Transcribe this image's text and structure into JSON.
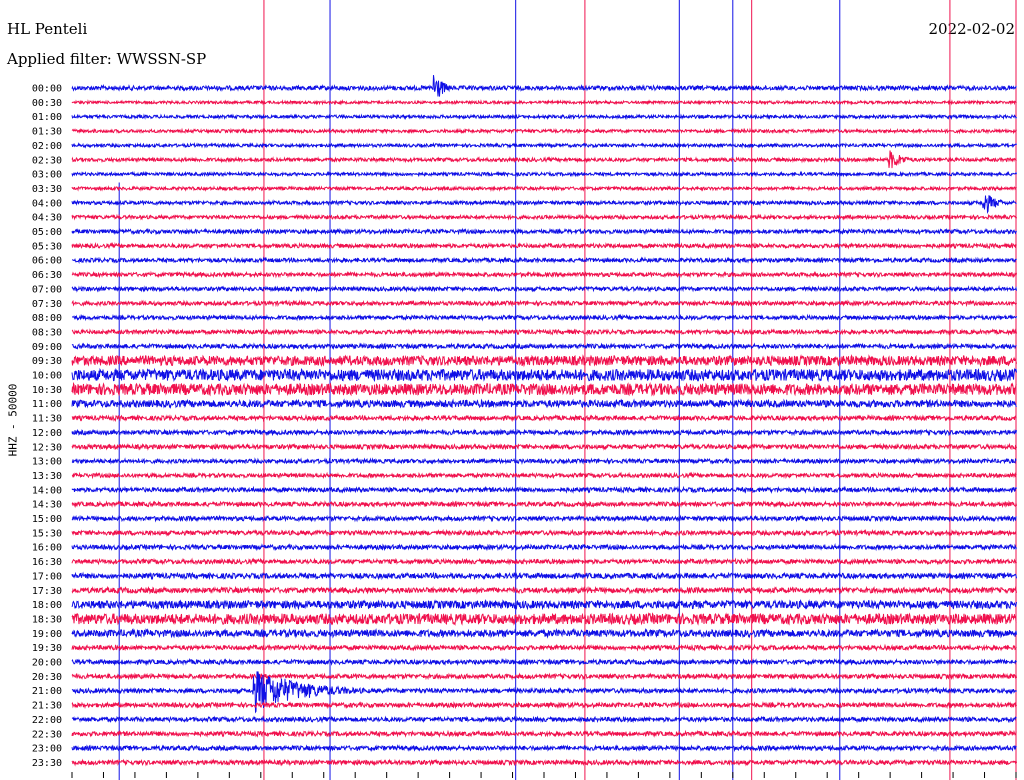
{
  "header": {
    "station": "HL Penteli",
    "filter": "Applied filter: WWSSN-SP",
    "date": "2022-02-02"
  },
  "channel_label": "HHZ - 50000",
  "colors": {
    "blue": "#1010e6",
    "red": "#f0124e",
    "axis": "#000000"
  },
  "chart_data": {
    "type": "line",
    "title": "HL Penteli",
    "subtitle": "Applied filter: WWSSN-SP",
    "ylabel": "HHZ - 50000",
    "xlabel": "",
    "line_labels": [
      "00:00",
      "00:30",
      "01:00",
      "01:30",
      "02:00",
      "02:30",
      "03:00",
      "03:30",
      "04:00",
      "04:30",
      "05:00",
      "05:30",
      "06:00",
      "06:30",
      "07:00",
      "07:30",
      "08:00",
      "08:30",
      "09:00",
      "09:30",
      "10:00",
      "10:30",
      "11:00",
      "11:30",
      "12:00",
      "12:30",
      "13:00",
      "13:30",
      "14:00",
      "14:30",
      "15:00",
      "15:30",
      "16:00",
      "16:30",
      "17:00",
      "17:30",
      "18:00",
      "18:30",
      "19:00",
      "19:30",
      "20:00",
      "20:30",
      "21:00",
      "21:30",
      "22:00",
      "22:30",
      "23:00",
      "23:30"
    ],
    "line_color_pattern": [
      "blue",
      "red"
    ],
    "minutes_per_line": 30,
    "noise_level": [
      1,
      0.6,
      0.7,
      0.7,
      0.7,
      0.8,
      0.7,
      0.7,
      0.8,
      0.8,
      0.9,
      0.9,
      0.9,
      0.9,
      0.9,
      0.9,
      0.9,
      0.9,
      1.0,
      2.2,
      2.6,
      2.6,
      1.6,
      1.0,
      1.0,
      1.0,
      0.9,
      0.9,
      1.0,
      1.0,
      1.0,
      1.0,
      1.0,
      1.0,
      1.2,
      1.2,
      1.8,
      2.4,
      1.6,
      1.0,
      1.0,
      1.0,
      1.0,
      1.0,
      1.0,
      1.0,
      1.0,
      1.0
    ],
    "events": [
      {
        "line": 0,
        "minute": 11.5,
        "amplitude": 18,
        "duration_min": 0.6
      },
      {
        "line": 5,
        "minute": 26.0,
        "amplitude": 10,
        "duration_min": 1.0
      },
      {
        "line": 8,
        "minute": 29.0,
        "amplitude": 12,
        "duration_min": 0.8
      },
      {
        "line": 42,
        "minute": 5.8,
        "amplitude": 22,
        "duration_min": 3.5
      }
    ],
    "vertical_markers": [
      {
        "minute": 1.5,
        "color": "blue",
        "from_line": 7,
        "to_line": 47
      },
      {
        "minute": 6.1,
        "color": "red",
        "from_line": 0,
        "to_line": 47
      },
      {
        "minute": 8.2,
        "color": "blue",
        "from_line": 0,
        "to_line": 47
      },
      {
        "minute": 14.1,
        "color": "blue",
        "from_line": 0,
        "to_line": 47
      },
      {
        "minute": 16.3,
        "color": "red",
        "from_line": 0,
        "to_line": 47
      },
      {
        "minute": 19.3,
        "color": "blue",
        "from_line": 0,
        "to_line": 47
      },
      {
        "minute": 21.0,
        "color": "blue",
        "from_line": 0,
        "to_line": 47
      },
      {
        "minute": 21.6,
        "color": "red",
        "from_line": 0,
        "to_line": 47
      },
      {
        "minute": 24.4,
        "color": "blue",
        "from_line": 0,
        "to_line": 47
      },
      {
        "minute": 27.9,
        "color": "red",
        "from_line": 0,
        "to_line": 47
      },
      {
        "minute": 30.0,
        "color": "red",
        "from_line": 0,
        "to_line": 47
      }
    ]
  }
}
